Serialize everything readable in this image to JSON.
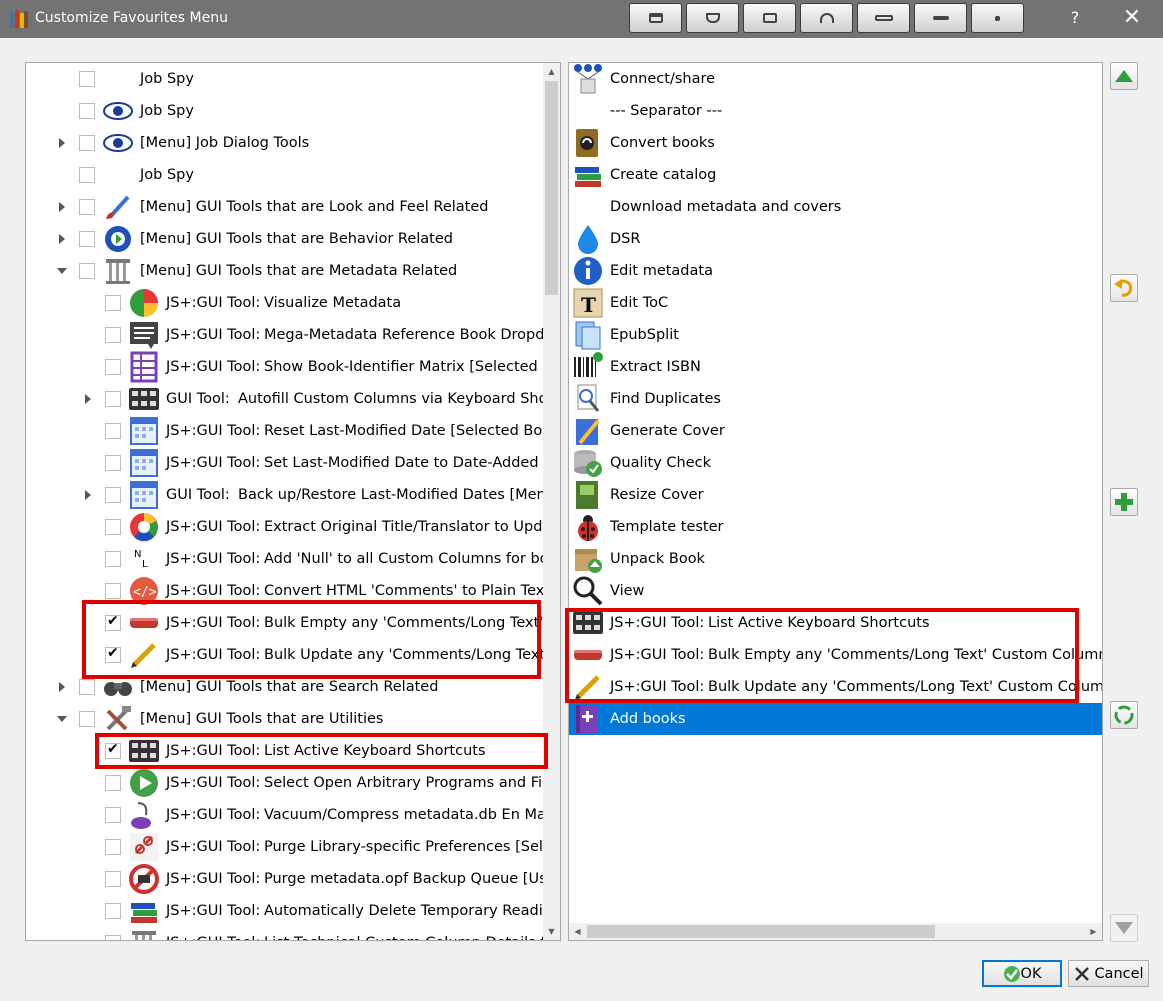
{
  "window": {
    "title": "Customize Favourites Menu",
    "help_label": "?",
    "close_label": "✕"
  },
  "left_items": [
    {
      "label": "Job Spy",
      "indent": 0,
      "expander": "none",
      "checked": false,
      "icon": "blank"
    },
    {
      "label": "Job Spy",
      "indent": 0,
      "expander": "none",
      "checked": false,
      "icon": "eye-icon"
    },
    {
      "label": "[Menu] Job Dialog Tools",
      "indent": 0,
      "expander": "collapsed",
      "checked": false,
      "icon": "eye-icon"
    },
    {
      "label": "Job Spy",
      "indent": 0,
      "expander": "none",
      "checked": false,
      "icon": "blank"
    },
    {
      "label": "[Menu] GUI Tools that are Look and Feel Related",
      "indent": 0,
      "expander": "collapsed",
      "checked": false,
      "icon": "paintbrush-icon"
    },
    {
      "label": "[Menu] GUI Tools that are Behavior Related",
      "indent": 0,
      "expander": "collapsed",
      "checked": false,
      "icon": "gear-icon"
    },
    {
      "label": "[Menu] GUI Tools that are Metadata Related",
      "indent": 0,
      "expander": "expanded",
      "checked": false,
      "icon": "pillar-icon"
    },
    {
      "type": "JS+:GUI Tool:",
      "desc": "Visualize Metadata",
      "indent": 1,
      "expander": "none",
      "checked": false,
      "icon": "pie-chart-icon"
    },
    {
      "type": "JS+:GUI Tool:",
      "desc": "Mega-Metadata Reference Book Dropd...",
      "indent": 1,
      "expander": "none",
      "checked": false,
      "icon": "speech-list-icon"
    },
    {
      "type": "JS+:GUI Tool:",
      "desc": "Show Book-Identifier Matrix [Selected B...",
      "indent": 1,
      "expander": "none",
      "checked": false,
      "icon": "grid-icon"
    },
    {
      "type": "GUI Tool:",
      "desc": "Autofill Custom Columns via Keyboard Shor...",
      "indent": 1,
      "expander": "collapsed",
      "checked": false,
      "icon": "keyboard-icon"
    },
    {
      "type": "JS+:GUI Tool:",
      "desc": "Reset Last-Modified Date [Selected Bo...",
      "indent": 1,
      "expander": "none",
      "checked": false,
      "icon": "calendar-icon"
    },
    {
      "type": "JS+:GUI Tool:",
      "desc": "Set Last-Modified Date to Date-Added ...",
      "indent": 1,
      "expander": "none",
      "checked": false,
      "icon": "calendar-icon"
    },
    {
      "type": "GUI Tool:",
      "desc": "Back up/Restore Last-Modified Dates [Menu]",
      "indent": 1,
      "expander": "collapsed",
      "checked": false,
      "icon": "calendar-icon"
    },
    {
      "type": "JS+:GUI Tool:",
      "desc": "Extract Original Title/Translator to Upda...",
      "indent": 1,
      "expander": "none",
      "checked": false,
      "icon": "color-wheel-icon"
    },
    {
      "type": "JS+:GUI Tool:",
      "desc": "Add 'Null' to all Custom Columns for bo...",
      "indent": 1,
      "expander": "none",
      "checked": false,
      "icon": "null-icon"
    },
    {
      "type": "JS+:GUI Tool:",
      "desc": "Convert HTML 'Comments' to Plain Text ...",
      "indent": 1,
      "expander": "none",
      "checked": false,
      "icon": "code-icon"
    },
    {
      "type": "JS+:GUI Tool:",
      "desc": "Bulk Empty any 'Comments/Long Text' C...",
      "indent": 1,
      "expander": "none",
      "checked": true,
      "icon": "eraser-icon"
    },
    {
      "type": "JS+:GUI Tool:",
      "desc": "Bulk Update any 'Comments/Long Text' ...",
      "indent": 1,
      "expander": "none",
      "checked": true,
      "icon": "pencil-icon"
    },
    {
      "label": "[Menu] GUI Tools that are Search Related",
      "indent": 0,
      "expander": "collapsed",
      "checked": false,
      "icon": "binoculars-icon"
    },
    {
      "label": "[Menu] GUI Tools that are Utilities",
      "indent": 0,
      "expander": "expanded",
      "checked": false,
      "icon": "tools-icon"
    },
    {
      "type": "JS+:GUI Tool:",
      "desc": "List Active Keyboard Shortcuts",
      "indent": 1,
      "expander": "none",
      "checked": true,
      "icon": "keyboard-icon"
    },
    {
      "type": "JS+:GUI Tool:",
      "desc": "Select  Open Arbitrary Programs and Files",
      "indent": 1,
      "expander": "none",
      "checked": false,
      "icon": "play-icon"
    },
    {
      "type": "JS+:GUI Tool:",
      "desc": "Vacuum/Compress metadata.db En Mas...",
      "indent": 1,
      "expander": "none",
      "checked": false,
      "icon": "vacuum-icon"
    },
    {
      "type": "JS+:GUI Tool:",
      "desc": "Purge Library-specific Preferences [Sele...",
      "indent": 1,
      "expander": "none",
      "checked": false,
      "icon": "broken-link-icon"
    },
    {
      "type": "JS+:GUI Tool:",
      "desc": "Purge metadata.opf Backup Queue [Use...",
      "indent": 1,
      "expander": "none",
      "checked": false,
      "icon": "no-entry-icon"
    },
    {
      "type": "JS+:GUI Tool:",
      "desc": "Automatically Delete Temporary Readin...",
      "indent": 1,
      "expander": "none",
      "checked": false,
      "icon": "books-icon"
    },
    {
      "type": "JS+:GUI Tool:",
      "desc": "List Technical Custom Column Details f...",
      "indent": 1,
      "expander": "none",
      "checked": false,
      "icon": "pillar-icon"
    }
  ],
  "right_items": [
    {
      "label": "Connect/share",
      "icon": "network-icon"
    },
    {
      "label": "--- Separator ---",
      "icon": "blank"
    },
    {
      "label": "Convert books",
      "icon": "convert-book-icon"
    },
    {
      "label": "Create catalog",
      "icon": "books-icon"
    },
    {
      "label": "Download metadata and covers",
      "icon": "blank"
    },
    {
      "label": "DSR",
      "icon": "drop-icon"
    },
    {
      "label": "Edit metadata",
      "icon": "info-icon"
    },
    {
      "label": "Edit ToC",
      "icon": "tile-t-icon"
    },
    {
      "label": "EpubSplit",
      "icon": "epub-split-icon"
    },
    {
      "label": "Extract ISBN",
      "icon": "barcode-icon"
    },
    {
      "label": "Find Duplicates",
      "icon": "magnifier-page-icon"
    },
    {
      "label": "Generate Cover",
      "icon": "generate-cover-icon"
    },
    {
      "label": "Quality Check",
      "icon": "database-check-icon"
    },
    {
      "label": "Resize Cover",
      "icon": "resize-cover-icon"
    },
    {
      "label": "Template tester",
      "icon": "ladybug-icon"
    },
    {
      "label": "Unpack Book",
      "icon": "box-icon"
    },
    {
      "label": "View",
      "icon": "magnifier-icon"
    },
    {
      "type": "JS+:GUI Tool:",
      "desc": "List Active Keyboard Shortcuts",
      "icon": "keyboard-icon"
    },
    {
      "type": "JS+:GUI Tool:",
      "desc": "Bulk Empty any 'Comments/Long Text' Custom Column of al",
      "icon": "eraser-icon"
    },
    {
      "type": "JS+:GUI Tool:",
      "desc": "Bulk Update any 'Comments/Long Text' Custom Column fron",
      "icon": "pencil-icon"
    },
    {
      "label": "Add books",
      "icon": "add-books-icon",
      "selected": true
    }
  ],
  "buttons": {
    "ok": "OK",
    "cancel": "Cancel"
  },
  "colors": {
    "accent": "#0078d7",
    "highlight": "#e00000"
  }
}
